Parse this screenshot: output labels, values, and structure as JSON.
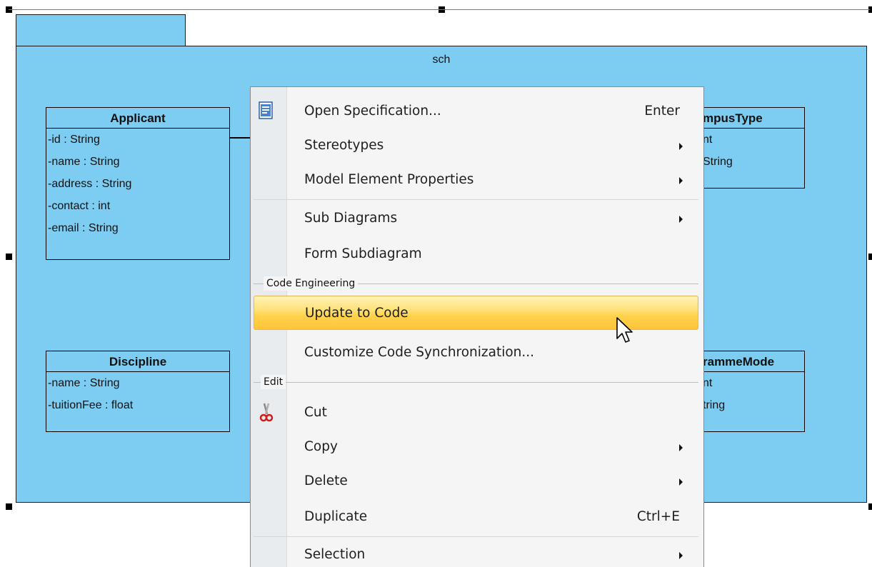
{
  "package": {
    "name": "sch"
  },
  "classes": [
    {
      "name": "Applicant",
      "attributes": [
        "-id : String",
        "-name : String",
        "-address : String",
        "-contact : int",
        "-email : String"
      ]
    },
    {
      "name": "Discipline",
      "attributes": [
        "-name : String",
        "-tuitionFee : float"
      ]
    },
    {
      "name": "mpusType",
      "attributes": [
        "nt",
        "String"
      ]
    },
    {
      "name": "rammeMode",
      "attributes": [
        "nt",
        "tring"
      ]
    }
  ],
  "menu": {
    "items": [
      {
        "label": "Open Specification...",
        "shortcut": "Enter",
        "icon": "specification-icon"
      },
      {
        "label": "Stereotypes",
        "submenu": true
      },
      {
        "label": "Model Element Properties",
        "submenu": true
      },
      {
        "label": "Sub Diagrams",
        "submenu": true
      },
      {
        "label": "Form Subdiagram"
      },
      {
        "label": "Update to Code",
        "highlighted": true
      },
      {
        "label": "Customize Code Synchronization..."
      },
      {
        "label": "Cut",
        "icon": "scissors-icon"
      },
      {
        "label": "Copy",
        "submenu": true
      },
      {
        "label": "Delete",
        "submenu": true
      },
      {
        "label": "Duplicate",
        "shortcut": "Ctrl+E"
      },
      {
        "label": "Selection",
        "submenu": true
      }
    ],
    "groups": {
      "code_engineering": "Code Engineering",
      "edit": "Edit"
    }
  },
  "colors": {
    "package_fill": "#7dcdf2",
    "highlight": "#ffd24a",
    "menu_bg": "#f5f5f5"
  }
}
